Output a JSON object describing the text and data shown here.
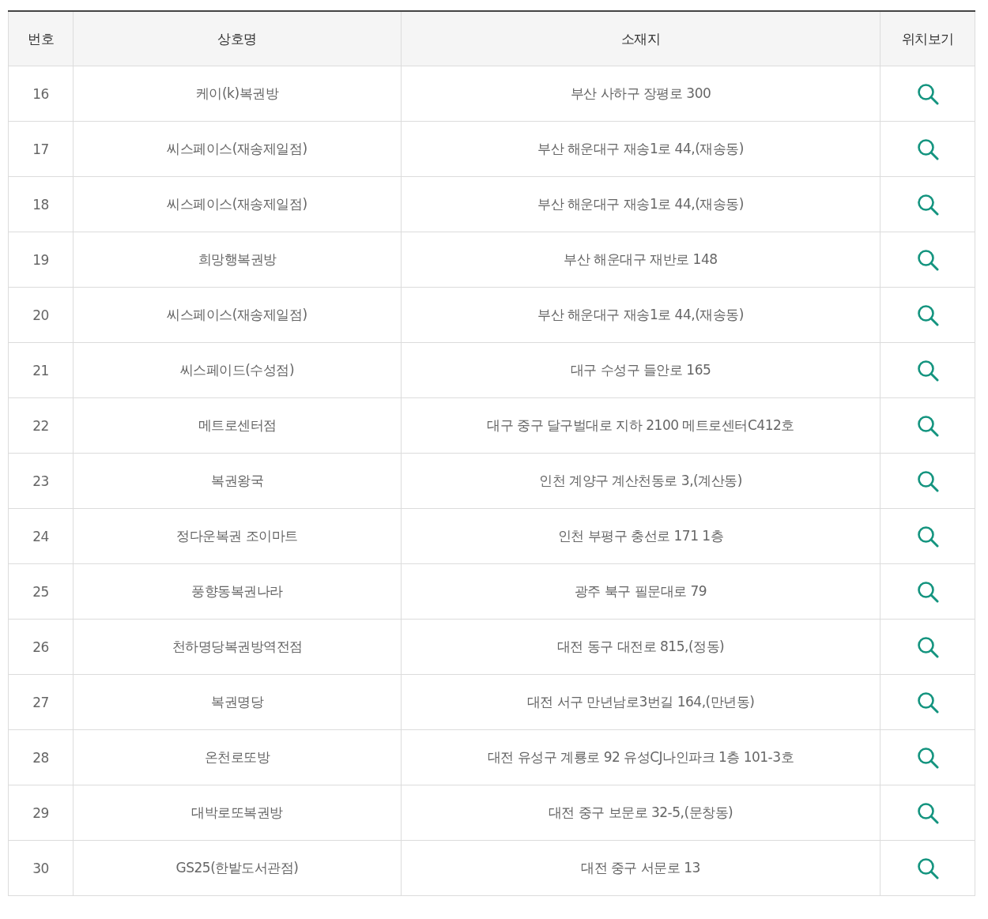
{
  "table": {
    "columns": [
      "번호",
      "상호명",
      "소재지",
      "위치보기"
    ],
    "rows": [
      {
        "number": "16",
        "name": "케이(k)복권방",
        "address": "부산 사하구 장평로 300"
      },
      {
        "number": "17",
        "name": "씨스페이스(재송제일점)",
        "address": "부산 해운대구 재송1로 44,(재송동)"
      },
      {
        "number": "18",
        "name": "씨스페이스(재송제일점)",
        "address": "부산 해운대구 재송1로 44,(재송동)"
      },
      {
        "number": "19",
        "name": "희망행복권방",
        "address": "부산 해운대구 재반로 148"
      },
      {
        "number": "20",
        "name": "씨스페이스(재송제일점)",
        "address": "부산 해운대구 재송1로 44,(재송동)"
      },
      {
        "number": "21",
        "name": "씨스페이드(수성점)",
        "address": "대구 수성구 들안로 165"
      },
      {
        "number": "22",
        "name": "메트로센터점",
        "address": "대구 중구 달구벌대로 지하 2100 메트로센터C412호"
      },
      {
        "number": "23",
        "name": "복권왕국",
        "address": "인천 계양구 계산천동로 3,(계산동)"
      },
      {
        "number": "24",
        "name": "정다운복권 조이마트",
        "address": "인천 부평구 충선로 171 1층"
      },
      {
        "number": "25",
        "name": "풍향동복권나라",
        "address": "광주 북구 필문대로 79"
      },
      {
        "number": "26",
        "name": "천하명당복권방역전점",
        "address": "대전 동구 대전로 815,(정동)"
      },
      {
        "number": "27",
        "name": "복권명당",
        "address": "대전 서구 만년남로3번길 164,(만년동)"
      },
      {
        "number": "28",
        "name": "온천로또방",
        "address": "대전 유성구 계룡로 92 유성CJ나인파크 1층 101-3호"
      },
      {
        "number": "29",
        "name": "대박로또복권방",
        "address": "대전 중구 보문로 32-5,(문창동)"
      },
      {
        "number": "30",
        "name": "GS25(한밭도서관점)",
        "address": "대전 중구 서문로 13"
      }
    ]
  }
}
